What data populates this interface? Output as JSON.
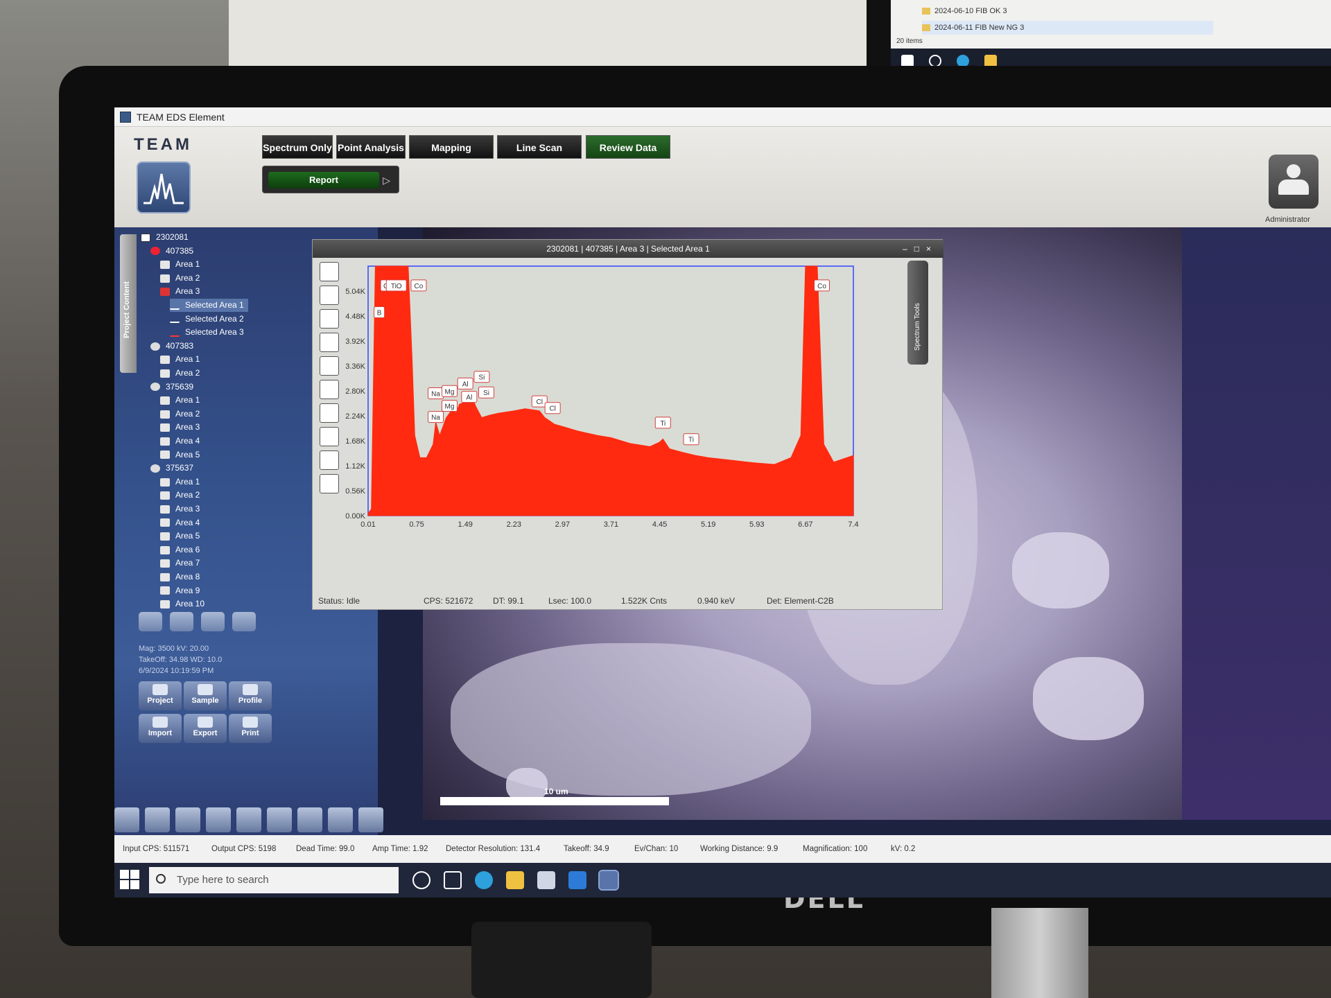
{
  "second_monitor": {
    "rows": [
      "2024-06-10 FIB OK 3",
      "2024-06-11 FIB New NG 3"
    ],
    "count": "20 items"
  },
  "window": {
    "title": "TEAM EDS Element"
  },
  "brand": {
    "name": "TEAM"
  },
  "tabs": [
    {
      "label": "Spectrum Only",
      "active": false
    },
    {
      "label": "Point Analysis",
      "active": false
    },
    {
      "label": "Mapping",
      "active": false
    },
    {
      "label": "Line Scan",
      "active": false
    },
    {
      "label": "Review Data",
      "active": true
    }
  ],
  "report": {
    "label": "Report"
  },
  "user": {
    "label": "Administrator"
  },
  "sidebar": {
    "strip_label": "Project Content",
    "tree": [
      {
        "label": "2302081",
        "kind": "proj",
        "indent": 0
      },
      {
        "label": "407385",
        "kind": "sample-red",
        "indent": 1
      },
      {
        "label": "Area 1",
        "kind": "area",
        "indent": 2
      },
      {
        "label": "Area 2",
        "kind": "area",
        "indent": 2
      },
      {
        "label": "Area 3",
        "kind": "area-red",
        "indent": 2
      },
      {
        "label": "Selected Area 1",
        "kind": "spec",
        "indent": 3,
        "selected": true
      },
      {
        "label": "Selected Area 2",
        "kind": "spec",
        "indent": 3
      },
      {
        "label": "Selected Area 3",
        "kind": "spec-red",
        "indent": 3
      },
      {
        "label": "407383",
        "kind": "sample",
        "indent": 1
      },
      {
        "label": "Area 1",
        "kind": "area",
        "indent": 2
      },
      {
        "label": "Area 2",
        "kind": "area",
        "indent": 2
      },
      {
        "label": "375639",
        "kind": "sample",
        "indent": 1
      },
      {
        "label": "Area 1",
        "kind": "area",
        "indent": 2
      },
      {
        "label": "Area 2",
        "kind": "area",
        "indent": 2
      },
      {
        "label": "Area 3",
        "kind": "area",
        "indent": 2
      },
      {
        "label": "Area 4",
        "kind": "area",
        "indent": 2
      },
      {
        "label": "Area 5",
        "kind": "area",
        "indent": 2
      },
      {
        "label": "375637",
        "kind": "sample",
        "indent": 1
      },
      {
        "label": "Area 1",
        "kind": "area",
        "indent": 2
      },
      {
        "label": "Area 2",
        "kind": "area",
        "indent": 2
      },
      {
        "label": "Area 3",
        "kind": "area",
        "indent": 2
      },
      {
        "label": "Area 4",
        "kind": "area",
        "indent": 2
      },
      {
        "label": "Area 5",
        "kind": "area",
        "indent": 2
      },
      {
        "label": "Area 6",
        "kind": "area",
        "indent": 2
      },
      {
        "label": "Area 7",
        "kind": "area",
        "indent": 2
      },
      {
        "label": "Area 8",
        "kind": "area",
        "indent": 2
      },
      {
        "label": "Area 9",
        "kind": "area",
        "indent": 2
      },
      {
        "label": "Area 10",
        "kind": "area",
        "indent": 2
      }
    ],
    "meta": [
      "Mag: 3500 kV: 20.00",
      "TakeOff: 34.98 WD: 10.0",
      "6/9/2024 10:19:59 PM"
    ],
    "panel_buttons": [
      "Project",
      "Sample",
      "Profile",
      "Import",
      "Export",
      "Print"
    ]
  },
  "spectrum": {
    "title": "2302081 | 407385 | Area 3 | Selected Area 1",
    "side_tab": "Spectrum Tools",
    "status": {
      "state": "Status: Idle",
      "cps": "CPS: 521672",
      "dt": "DT: 99.1",
      "lsec": "Lsec: 100.0",
      "cnts": "1.522K Cnts",
      "kev": "0.940 keV",
      "det": "Det: Element-C2B"
    }
  },
  "image": {
    "scale_label": "10 um"
  },
  "statusbar": {
    "input_cps": "Input CPS: 511571",
    "output_cps": "Output CPS: 5198",
    "dead_time": "Dead Time: 99.0",
    "amp_time": "Amp Time: 1.92",
    "detector_resolution": "Detector Resolution: 131.4",
    "takeoff": "Takeoff: 34.9",
    "ev_chan": "Ev/Chan: 10",
    "working_distance": "Working Distance: 9.9",
    "magnification": "Magnification: 100",
    "kv": "kV: 0.2"
  },
  "taskbar": {
    "search_placeholder": "Type here to search"
  },
  "brand_footer": "DELL",
  "chart_data": {
    "type": "area",
    "color": "#ff2a10",
    "x_ticks": [
      0.01,
      0.75,
      1.49,
      2.23,
      2.97,
      3.71,
      4.45,
      5.19,
      5.93,
      6.67,
      7.4
    ],
    "y_ticks": [
      "0.00K",
      "0.56K",
      "1.12K",
      "1.68K",
      "2.24K",
      "2.80K",
      "3.36K",
      "3.92K",
      "4.48K",
      "5.04K"
    ],
    "xlim": [
      0.01,
      7.4
    ],
    "ylim": [
      0,
      5.6
    ],
    "x": [
      0.01,
      0.06,
      0.12,
      0.2,
      0.3,
      0.45,
      0.55,
      0.62,
      0.68,
      0.72,
      0.8,
      0.9,
      1.0,
      1.04,
      1.1,
      1.2,
      1.3,
      1.35,
      1.4,
      1.49,
      1.55,
      1.6,
      1.65,
      1.74,
      1.85,
      2.0,
      2.23,
      2.4,
      2.62,
      2.7,
      2.85,
      2.97,
      3.2,
      3.5,
      3.71,
      4.0,
      4.3,
      4.45,
      4.5,
      4.6,
      4.8,
      5.0,
      5.19,
      5.5,
      5.8,
      5.93,
      6.2,
      6.45,
      6.6,
      6.67,
      6.72,
      6.78,
      6.85,
      6.95,
      7.1,
      7.2,
      7.4
    ],
    "y": [
      0.05,
      0.15,
      5.6,
      5.6,
      5.6,
      5.6,
      5.6,
      5.6,
      3.5,
      1.8,
      1.3,
      1.3,
      1.6,
      2.1,
      1.8,
      2.2,
      2.4,
      2.3,
      2.5,
      2.55,
      2.6,
      2.65,
      2.45,
      2.2,
      2.25,
      2.3,
      2.35,
      2.4,
      2.35,
      2.2,
      2.05,
      2.0,
      1.9,
      1.8,
      1.75,
      1.62,
      1.55,
      1.65,
      1.72,
      1.5,
      1.42,
      1.35,
      1.3,
      1.25,
      1.2,
      1.18,
      1.15,
      1.3,
      1.8,
      5.6,
      5.6,
      5.6,
      5.6,
      1.6,
      1.2,
      1.25,
      1.35
    ],
    "annotations": [
      {
        "label": "C",
        "x": 0.28,
        "y": 5.15
      },
      {
        "label": "TiO",
        "x": 0.44,
        "y": 5.15
      },
      {
        "label": "Co",
        "x": 0.78,
        "y": 5.15
      },
      {
        "label": "B",
        "x": 0.18,
        "y": 4.55
      },
      {
        "label": "Na",
        "x": 1.04,
        "y": 2.73
      },
      {
        "label": "Mg",
        "x": 1.25,
        "y": 2.78
      },
      {
        "label": "Al",
        "x": 1.49,
        "y": 2.95
      },
      {
        "label": "Si",
        "x": 1.74,
        "y": 3.1
      },
      {
        "label": "Mg",
        "x": 1.25,
        "y": 2.45
      },
      {
        "label": "Al",
        "x": 1.55,
        "y": 2.65
      },
      {
        "label": "Si",
        "x": 1.81,
        "y": 2.75
      },
      {
        "label": "Na",
        "x": 1.04,
        "y": 2.2
      },
      {
        "label": "Cl",
        "x": 2.62,
        "y": 2.55
      },
      {
        "label": "Cl",
        "x": 2.82,
        "y": 2.4
      },
      {
        "label": "Ti",
        "x": 4.5,
        "y": 2.07
      },
      {
        "label": "Ti",
        "x": 4.93,
        "y": 1.7
      },
      {
        "label": "Co",
        "x": 6.92,
        "y": 5.15
      }
    ]
  }
}
